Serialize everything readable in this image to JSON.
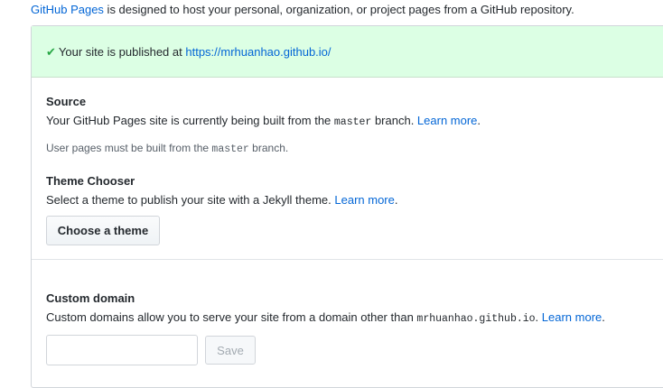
{
  "intro": {
    "link": "GitHub Pages",
    "text": " is designed to host your personal, organization, or project pages from a GitHub repository."
  },
  "flash": {
    "icon": "check-icon",
    "text": "Your site is published at ",
    "url": "https://mrhuanhao.github.io/",
    "color": "#dcffe4"
  },
  "source": {
    "heading": "Source",
    "desc_before": "Your GitHub Pages site is currently being built from the ",
    "branch": "master",
    "desc_after": " branch. ",
    "learn_more": "Learn more",
    "period": ".",
    "note_before": "User pages must be built from the ",
    "note_branch": "master",
    "note_after": " branch."
  },
  "theme": {
    "heading": "Theme Chooser",
    "desc": "Select a theme to publish your site with a Jekyll theme. ",
    "learn_more": "Learn more",
    "period": ".",
    "button": "Choose a theme"
  },
  "domain": {
    "heading": "Custom domain",
    "desc_before": "Custom domains allow you to serve your site from a domain other than ",
    "host": "mrhuanhao.github.io",
    "desc_after": ". ",
    "learn_more": "Learn more",
    "period": ".",
    "input_value": "",
    "save": "Save"
  }
}
